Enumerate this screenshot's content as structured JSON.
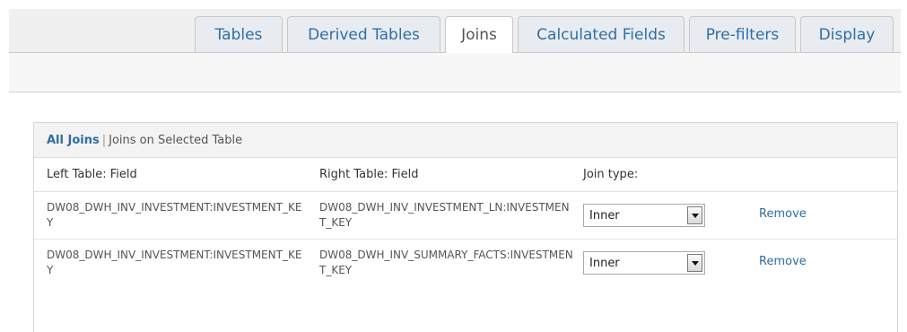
{
  "tabs": [
    {
      "label": "Tables"
    },
    {
      "label": "Derived Tables"
    },
    {
      "label": "Joins"
    },
    {
      "label": "Calculated Fields"
    },
    {
      "label": "Pre-filters"
    },
    {
      "label": "Display"
    }
  ],
  "active_tab": "Joins",
  "filter": {
    "all_label": "All Joins",
    "separator": "|",
    "selected_label": "Joins on Selected Table"
  },
  "table": {
    "headers": [
      "Left Table: Field",
      "Right Table: Field",
      "Join type:"
    ],
    "rows": [
      {
        "left": "DW08_DWH_INV_INVESTMENT:INVESTMENT_KEY",
        "right": "DW08_DWH_INV_INVESTMENT_LN:INVESTMENT_KEY",
        "join_type": "Inner",
        "action": "Remove"
      },
      {
        "left": "DW08_DWH_INV_INVESTMENT:INVESTMENT_KEY",
        "right": "DW08_DWH_INV_SUMMARY_FACTS:INVESTMENT_KEY",
        "join_type": "Inner",
        "action": "Remove"
      }
    ]
  },
  "colors": {
    "link": "#2e6ea6",
    "tab_bg": "#e8ecf0",
    "panel_header_bg": "#f3f3f3"
  }
}
